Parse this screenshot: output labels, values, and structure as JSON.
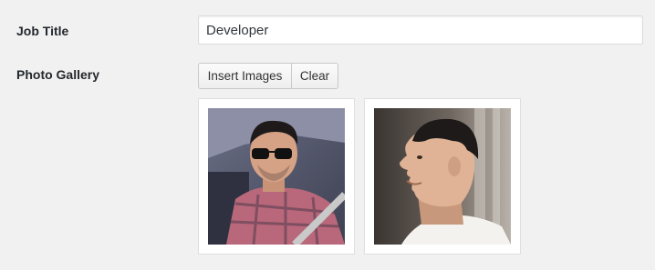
{
  "form": {
    "job_title": {
      "label": "Job Title",
      "value": "Developer"
    },
    "photo_gallery": {
      "label": "Photo Gallery",
      "insert_button": "Insert Images",
      "clear_button": "Clear",
      "images": [
        {
          "icon": "photo-car-selfie-sunglasses"
        },
        {
          "icon": "photo-profile-portrait"
        }
      ]
    }
  }
}
